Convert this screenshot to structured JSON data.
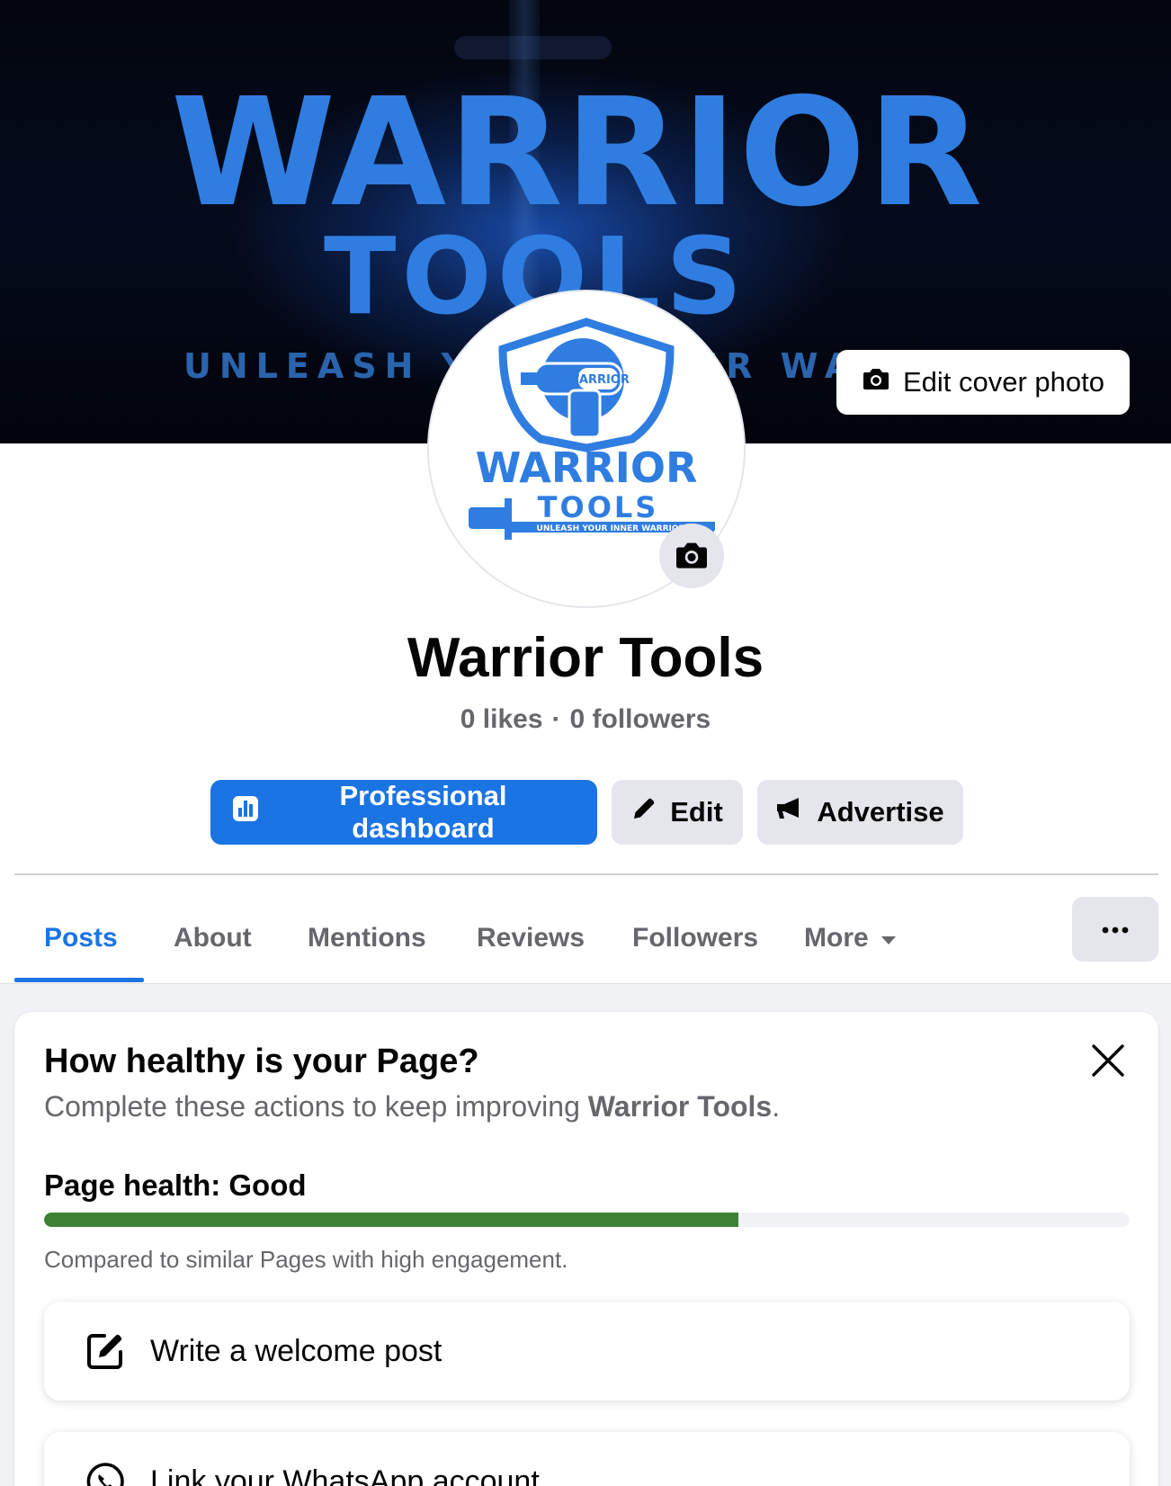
{
  "cover": {
    "brand_word_1": "WARRIOR",
    "brand_word_2": "TOOLS",
    "tagline": "UNLEASH YOUR INNER WARRIOR",
    "edit_cover_label": "Edit cover photo"
  },
  "avatar": {
    "badge_text": "WARRIOR",
    "brand_word_1": "WARRIOR",
    "brand_word_2": "TOOLS",
    "tagline": "UNLEASH YOUR INNER WARRIOR"
  },
  "profile": {
    "page_name": "Warrior Tools",
    "likes": "0 likes",
    "separator": "·",
    "followers": "0 followers"
  },
  "actions": {
    "dashboard_label": "Professional dashboard",
    "edit_label": "Edit",
    "advertise_label": "Advertise"
  },
  "tabs": [
    {
      "label": "Posts",
      "active": true
    },
    {
      "label": "About",
      "active": false
    },
    {
      "label": "Mentions",
      "active": false
    },
    {
      "label": "Reviews",
      "active": false
    },
    {
      "label": "Followers",
      "active": false
    },
    {
      "label": "More",
      "active": false
    }
  ],
  "health_card": {
    "title": "How healthy is your Page?",
    "subtitle_prefix": "Complete these actions to keep improving ",
    "subtitle_page": "Warrior Tools",
    "subtitle_suffix": ".",
    "health_label": "Page health: Good",
    "health_fraction": 0.64,
    "note": "Compared to similar Pages with high engagement.",
    "tasks": [
      {
        "label": "Write a welcome post",
        "icon": "edit-square-icon"
      },
      {
        "label": "Link your WhatsApp account",
        "icon": "whatsapp-icon"
      }
    ]
  },
  "colors": {
    "primary": "#1b74e4",
    "health_good": "#3d8135",
    "brand_blue": "#2f7de0"
  }
}
